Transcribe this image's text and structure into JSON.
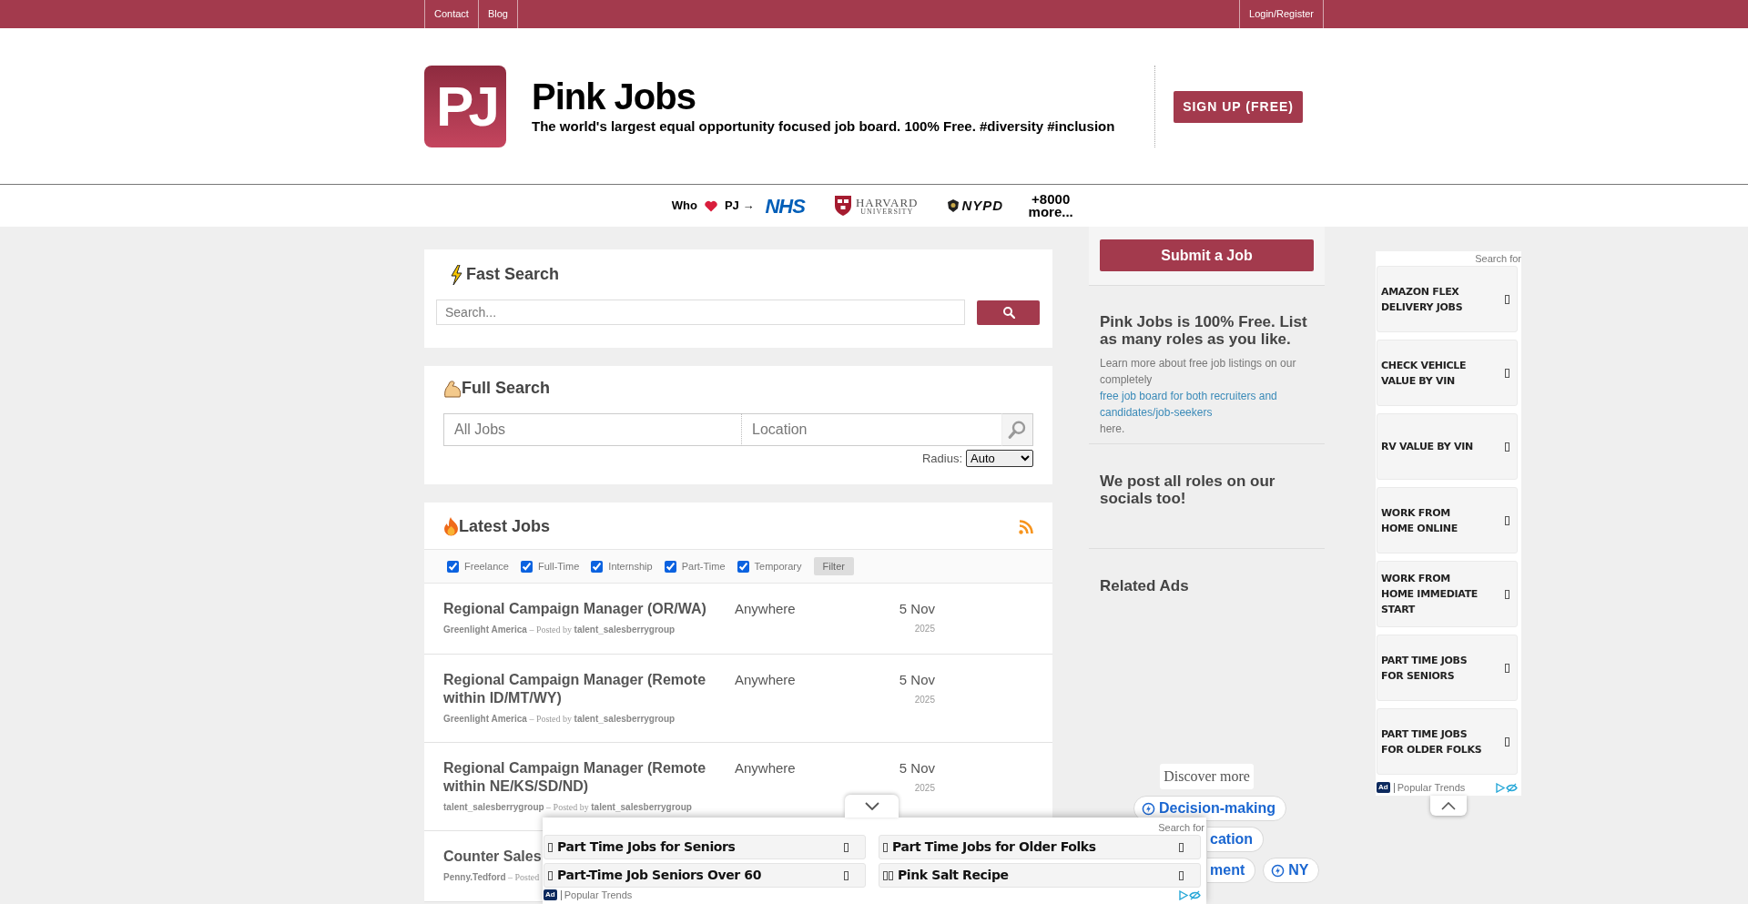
{
  "top_nav": {
    "left": [
      {
        "label": "Contact"
      },
      {
        "label": "Blog"
      }
    ],
    "right": [
      {
        "label": "Login/Register"
      }
    ]
  },
  "brand": {
    "logo_text": "PJ",
    "title": "Pink Jobs",
    "tagline": "The world's largest equal opportunity focused job board. 100% Free. #diversity #inclusion",
    "signup": "SIGN UP (FREE)"
  },
  "trust_strip": {
    "who": "Who",
    "pj": "PJ →",
    "logos": [
      {
        "kind": "nhs",
        "text": "NHS"
      },
      {
        "kind": "harvard",
        "text": "HARVARD",
        "subtext": "UNIVERSITY"
      },
      {
        "kind": "nypd",
        "text": "NYPD"
      }
    ],
    "more": "+8000 more..."
  },
  "fast_search": {
    "title": "Fast Search",
    "placeholder": "Search..."
  },
  "full_search": {
    "title": "Full Search",
    "jobs_placeholder": "All Jobs",
    "location_placeholder": "Location",
    "radius_label": "Radius:",
    "radius_value": "Auto"
  },
  "latest_jobs": {
    "title": "Latest Jobs",
    "filters": [
      {
        "label": "Freelance",
        "checked": true
      },
      {
        "label": "Full-Time",
        "checked": true
      },
      {
        "label": "Internship",
        "checked": true
      },
      {
        "label": "Part-Time",
        "checked": true
      },
      {
        "label": "Temporary",
        "checked": true
      }
    ],
    "filter_button": "Filter",
    "jobs": [
      {
        "title": "Regional Campaign Manager (OR/WA)",
        "company": "Greenlight America",
        "posted_by": "– Posted by",
        "poster": "talent_salesberrygroup",
        "location": "Anywhere",
        "date": "5 Nov",
        "year": "2025"
      },
      {
        "title": "Regional Campaign Manager (Remote within ID/MT/WY)",
        "company": "Greenlight America",
        "posted_by": "– Posted by",
        "poster": "talent_salesberrygroup",
        "location": "Anywhere",
        "date": "5 Nov",
        "year": "2025"
      },
      {
        "title": "Regional Campaign Manager (Remote within NE/KS/SD/ND)",
        "company": "talent_salesberrygroup",
        "posted_by": "– Posted by",
        "poster": "talent_salesberrygroup",
        "location": "Anywhere",
        "date": "5 Nov",
        "year": "2025"
      },
      {
        "title": "Counter Sales",
        "company": "Penny.Tedford",
        "posted_by": "– Posted"
      }
    ]
  },
  "sidebar": {
    "submit_button": "Submit a Job",
    "free_heading": "Pink Jobs is 100% Free. List as many roles as you like.",
    "free_text_before": "Learn more about free job listings on our completely",
    "free_link": "free job board for both recruiters and candidates/job-seekers",
    "free_text_after": "here.",
    "socials_heading": "We post all roles on our socials too!",
    "related_heading": "Related Ads",
    "discover": "Discover more",
    "chip_rows": [
      [
        {
          "label": "Decision-making",
          "cut": false
        }
      ],
      [
        {
          "label": "cation",
          "cut": true
        }
      ],
      [
        {
          "label": "ment",
          "cut": true
        },
        {
          "label": "NY",
          "cut": false
        }
      ]
    ]
  },
  "side_ad": {
    "search_for": "Search for",
    "items": [
      {
        "label": "AMAZON FLEX DELIVERY JOBS"
      },
      {
        "label": "CHECK VEHICLE VALUE BY VIN"
      },
      {
        "label": "RV VALUE BY VIN"
      },
      {
        "label": "WORK FROM HOME ONLINE"
      },
      {
        "label": "WORK FROM HOME IMMEDIATE START"
      },
      {
        "label": "PART TIME JOBS FOR SENIORS"
      },
      {
        "label": "PART TIME JOBS FOR OLDER FOLKS"
      }
    ],
    "ad_badge": "Ad",
    "brand": "Popular Trends"
  },
  "bottom_ad": {
    "search_for": "Search for",
    "items": [
      {
        "label": "Part Time Jobs for Seniors",
        "kind": "single"
      },
      {
        "label": "Part Time Jobs for Older Folks",
        "kind": "single"
      },
      {
        "label": "Part-Time Job Seniors Over 60",
        "kind": "single"
      },
      {
        "label": "Pink Salt Recipe",
        "kind": "double"
      }
    ],
    "ad_badge": "Ad",
    "brand": "Popular Trends"
  }
}
